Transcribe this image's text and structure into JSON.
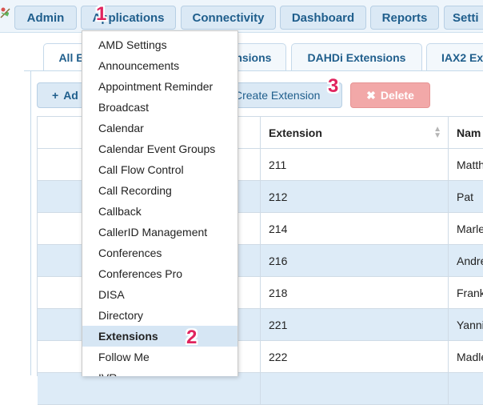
{
  "nav": {
    "items": [
      "Admin",
      "Applications",
      "Connectivity",
      "Dashboard",
      "Reports",
      "Setti"
    ]
  },
  "tabs": [
    "All E",
    "ensions",
    "DAHDi Extensions",
    "IAX2 Ext"
  ],
  "toolbar": {
    "add_icon": "+",
    "add_label": "Ad",
    "create_label": "Create Extension",
    "delete_icon": "✖",
    "delete_label": "Delete",
    "delete_color": "#f2a8a8"
  },
  "table": {
    "headers": [
      "",
      "Extension",
      "Nam"
    ],
    "rows": [
      {
        "extension": "211",
        "name": "Matth"
      },
      {
        "extension": "212",
        "name": "Pat"
      },
      {
        "extension": "214",
        "name": "Marle"
      },
      {
        "extension": "216",
        "name": "Andre"
      },
      {
        "extension": "218",
        "name": "Frank"
      },
      {
        "extension": "221",
        "name": "Yanni"
      },
      {
        "extension": "222",
        "name": "Madle"
      },
      {
        "extension": "",
        "name": ""
      }
    ]
  },
  "menu": {
    "items": [
      "AMD Settings",
      "Announcements",
      "Appointment Reminder",
      "Broadcast",
      "Calendar",
      "Calendar Event Groups",
      "Call Flow Control",
      "Call Recording",
      "Callback",
      "CallerID Management",
      "Conferences",
      "Conferences Pro",
      "DISA",
      "Directory",
      "Extensions",
      "Follow Me",
      "IVR"
    ],
    "selected": "Extensions"
  },
  "annotations": [
    "1",
    "2",
    "3"
  ],
  "colors": {
    "accent": "#1f5e8c",
    "annotation": "#e0245e",
    "row_alt": "#ddebf7",
    "menu_selected": "#d6e6f4"
  }
}
